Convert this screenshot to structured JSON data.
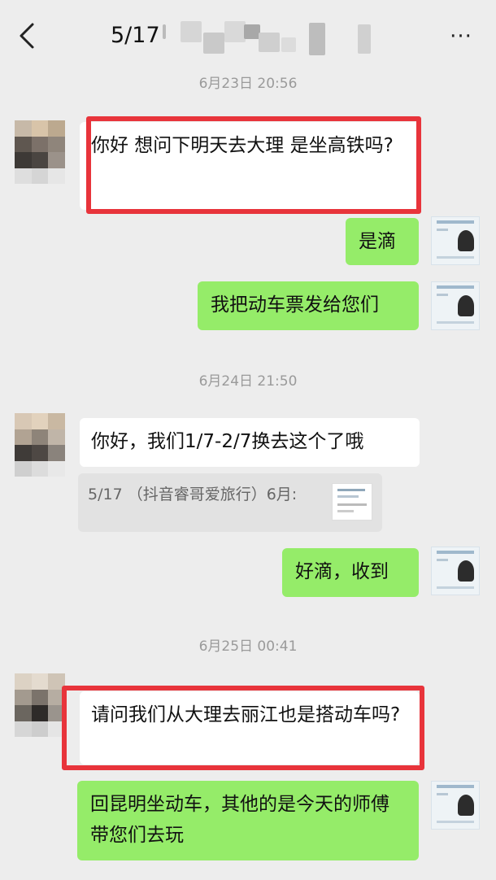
{
  "header": {
    "title": "5/17",
    "back_icon": "chevron-left-icon",
    "more_label": "···"
  },
  "messages": {
    "ts1": "6月23日 20:56",
    "m1": "你好 想问下明天去大理 是坐高铁吗?",
    "m2": "是滴",
    "m3": "我把动车票发给您们",
    "ts2": "6月24日 21:50",
    "m4": "你好，我们1/7-2/7换去这个了哦",
    "quote": "5/17 （抖音睿哥爱旅行）6月:",
    "m5": "好滴，收到",
    "ts3": "6月25日 00:41",
    "m6": "请问我们从大理去丽江也是搭动车吗?",
    "m7": "回昆明坐动车，其他的是今天的师傅带您们去玩"
  },
  "colors": {
    "background": "#ededed",
    "outgoing_bubble": "#95ec69",
    "incoming_bubble": "#ffffff",
    "highlight": "#e8343b"
  }
}
